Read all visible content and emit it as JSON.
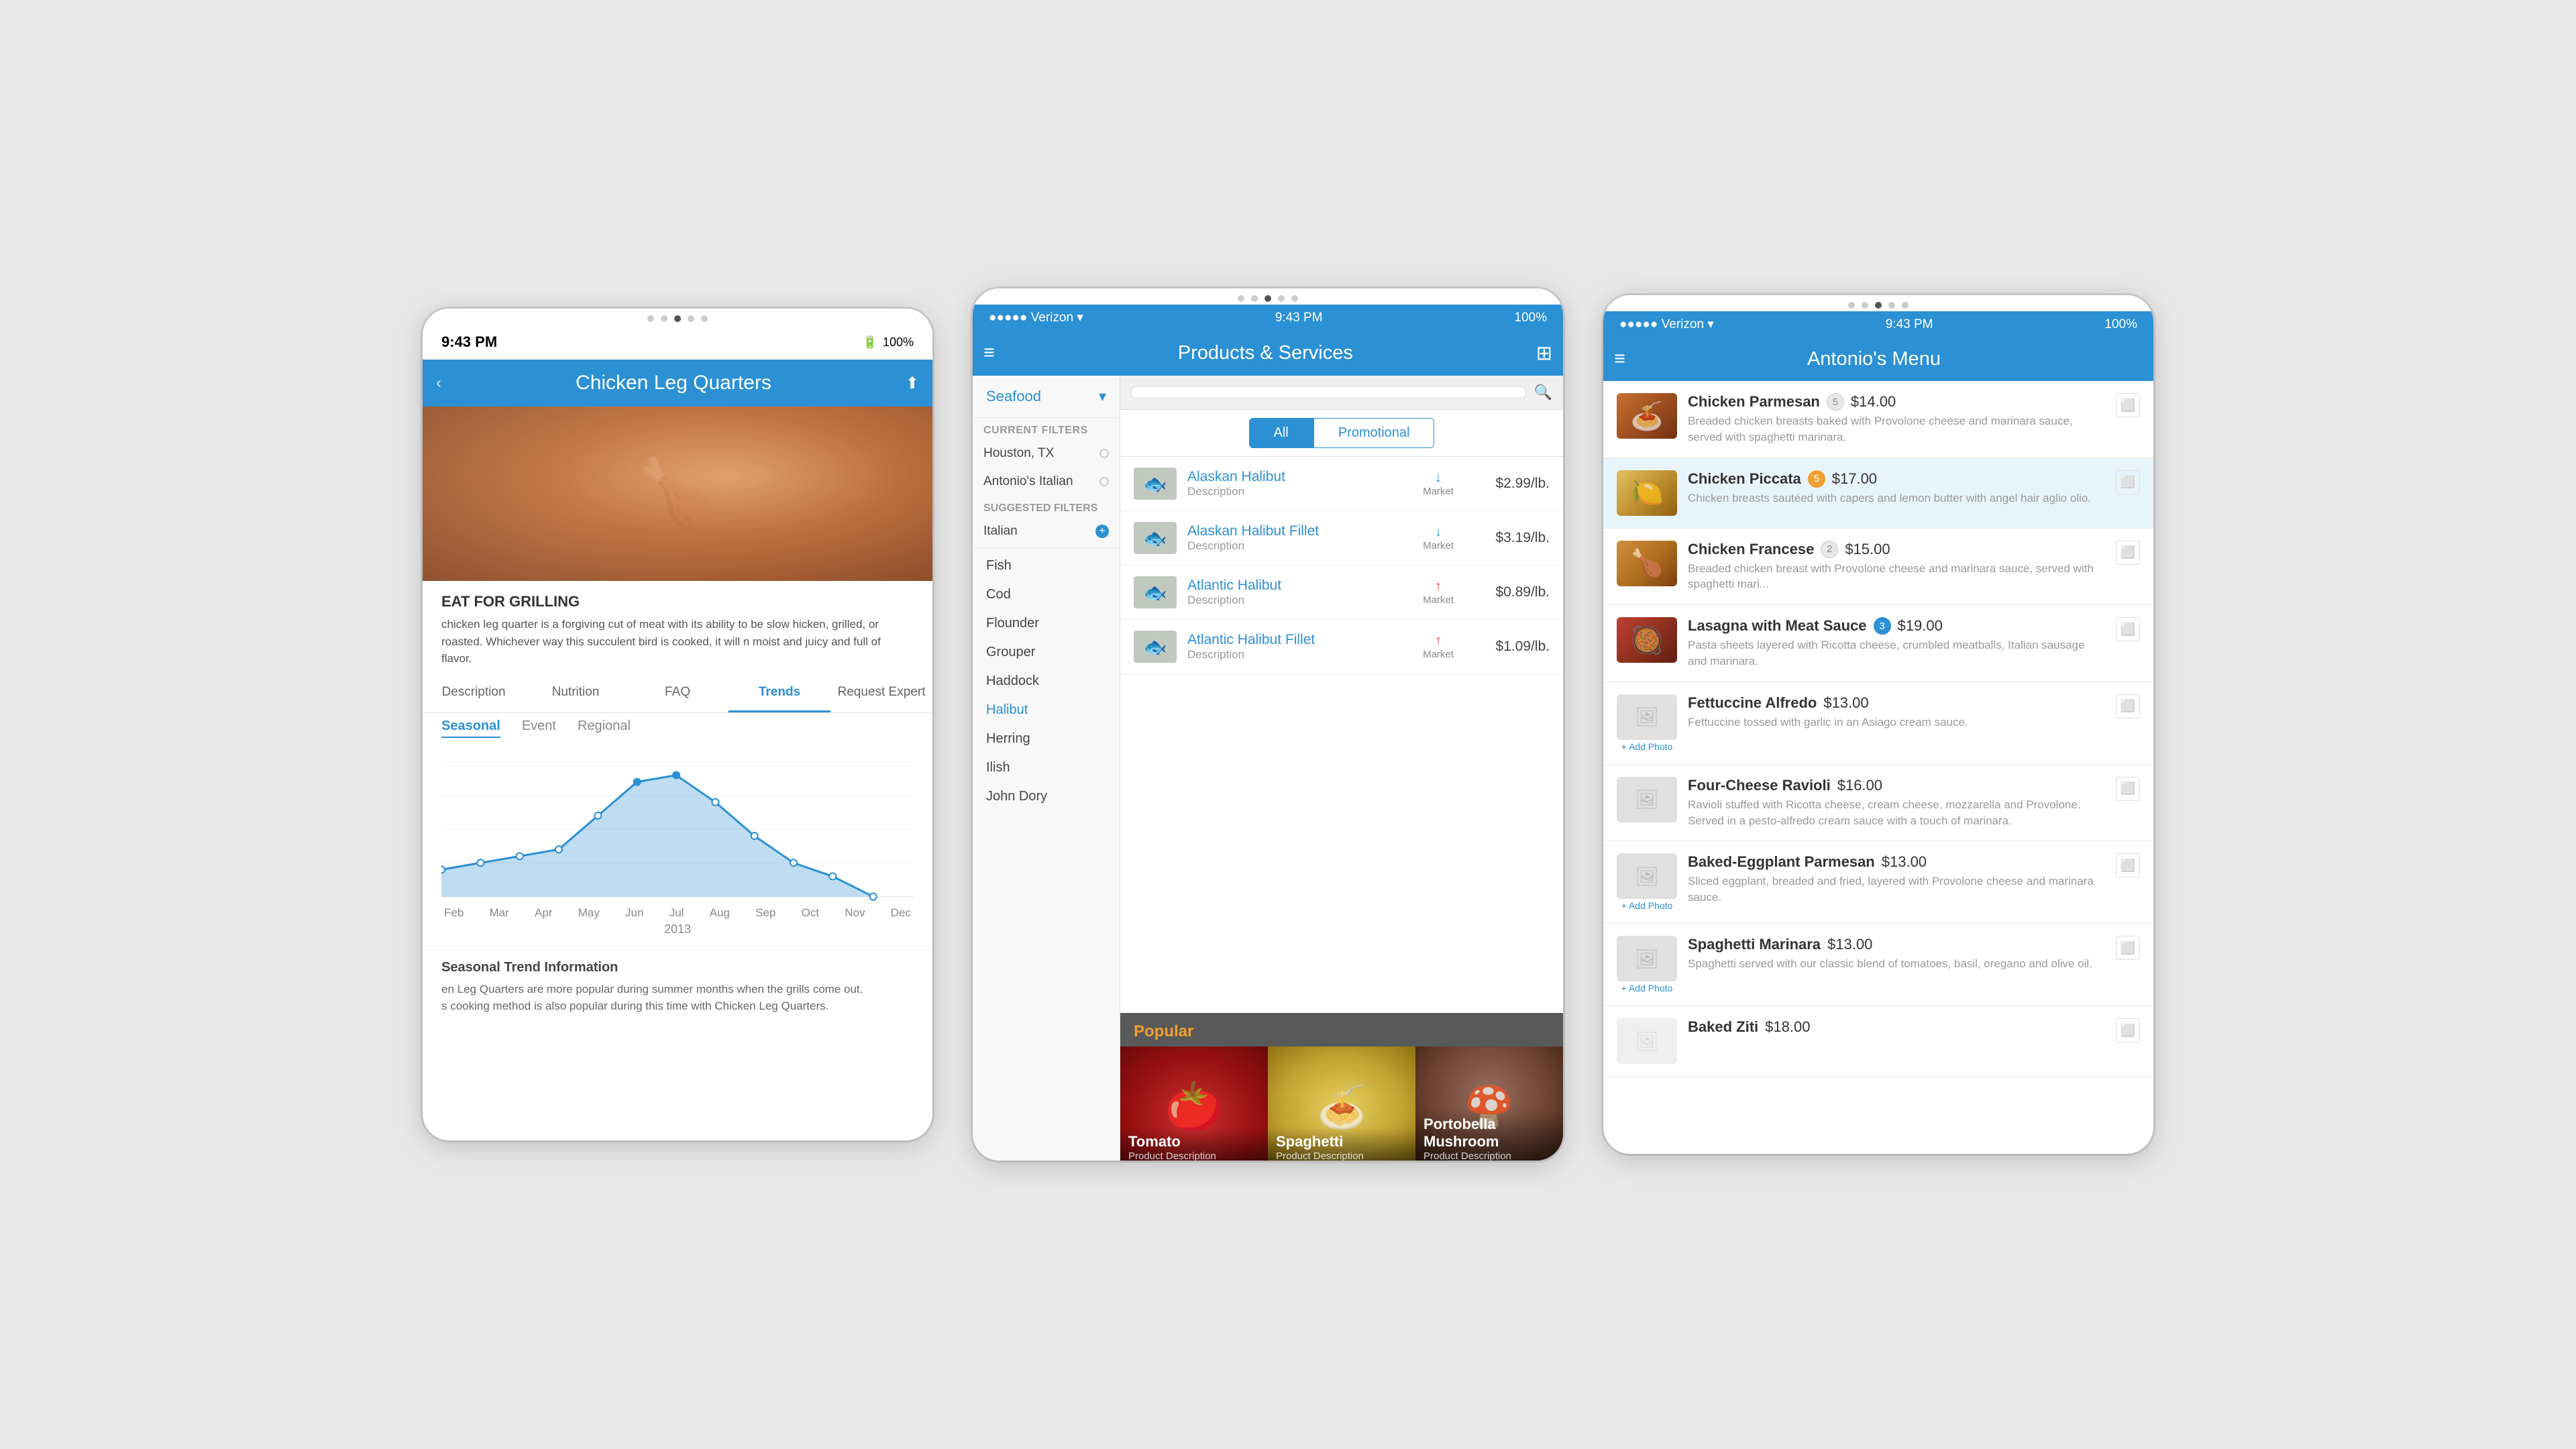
{
  "screen1": {
    "status_bar": {
      "time": "9:43 PM",
      "battery": "100%"
    },
    "header": {
      "title": "Chicken Leg Quarters",
      "back_label": "‹"
    },
    "tabs": [
      {
        "label": "Description",
        "active": false
      },
      {
        "label": "Nutrition",
        "active": false
      },
      {
        "label": "FAQ",
        "active": false
      },
      {
        "label": "Trends",
        "active": true
      },
      {
        "label": "Request Expert",
        "active": false
      }
    ],
    "chart": {
      "section_label": "onal Trend Information",
      "seasonal_label": "Seasonal",
      "event_label": "Event",
      "regional_label": "Regional",
      "year": "2013",
      "months": [
        "Feb",
        "Mar",
        "Apr",
        "May",
        "Jun",
        "Jul",
        "Aug",
        "Sep",
        "Oct",
        "Nov",
        "Dec",
        "Dec"
      ],
      "x_labels": [
        "Feb",
        "Mar",
        "Apr",
        "May",
        "Jun",
        "Jul",
        "Aug",
        "Sep",
        "Oct",
        "Nov",
        "Dec"
      ]
    },
    "trend_section": {
      "title": "onal Trend Information",
      "text_line1": "en Leg Quarters are more popular during summer months when the grills come out.",
      "text_line2": "s cooking method is also popular during this time with Chicken Leg Quarters."
    },
    "body_text": {
      "heading": "EAT FOR GRILLING",
      "para": "chicken leg quarter is a forgiving cut of meat with its ability to be slow\nhicken, grilled, or roasted. Whichever way this succulent bird is cooked, it will\nn moist and juicy and full of flavor."
    }
  },
  "screen2": {
    "status_bar": {
      "carrier": "●●●●● Verizon ▾",
      "time": "9:43 PM",
      "battery": "100%"
    },
    "header": {
      "title": "Products & Services",
      "menu_icon": "≡",
      "barcode_icon": "⊞"
    },
    "sidebar": {
      "category": "Seafood",
      "chevron": "▾",
      "current_filters_label": "Current Filters",
      "filters": [
        {
          "label": "Houston, TX",
          "checked": false
        },
        {
          "label": "Antonio's Italian",
          "checked": false
        }
      ],
      "suggested_filters_label": "Suggested Filters",
      "suggested_items": [
        {
          "label": "Italian",
          "has_add": true
        }
      ],
      "fish_items": [
        {
          "label": "Fish",
          "active": false,
          "indent": false
        },
        {
          "label": "Cod",
          "active": false
        },
        {
          "label": "Flounder",
          "active": false
        },
        {
          "label": "Grouper",
          "active": false
        },
        {
          "label": "Haddock",
          "active": false
        },
        {
          "label": "Halibut",
          "active": true
        },
        {
          "label": "Herring",
          "active": false
        },
        {
          "label": "Ilish",
          "active": false
        },
        {
          "label": "John Dory",
          "active": false
        }
      ]
    },
    "filter_bar": {
      "all_label": "All",
      "promo_label": "Promotional"
    },
    "products": [
      {
        "name": "Alaskan Halibut",
        "desc": "Description",
        "trend": "down",
        "trend_label": "Market",
        "price": "$2.99/lb."
      },
      {
        "name": "Alaskan Halibut Fillet",
        "desc": "Description",
        "trend": "down",
        "trend_label": "Market",
        "price": "$3.19/lb."
      },
      {
        "name": "Atlantic Halibut",
        "desc": "Description",
        "trend": "up",
        "trend_label": "Market",
        "price": "$0.89/lb."
      },
      {
        "name": "Atlantic Halibut Fillet",
        "desc": "Description",
        "trend": "up",
        "trend_label": "Market",
        "price": "$1.09/lb."
      }
    ],
    "popular": {
      "title": "Popular",
      "items": [
        {
          "name": "Tomato",
          "desc": "Product Description"
        },
        {
          "name": "Spaghetti",
          "desc": "Product Description"
        },
        {
          "name": "Portobella Mushroom",
          "desc": "Product Description"
        }
      ]
    }
  },
  "screen3": {
    "status_bar": {
      "carrier": "●●●●● Verizon ▾",
      "time": "9:43 PM",
      "battery": "100%"
    },
    "header": {
      "title": "Antonio's Menu",
      "menu_icon": "≡"
    },
    "menu_items": [
      {
        "name": "Chicken Parmesan",
        "badge": "5",
        "badge_type": "none",
        "price": "$14.00",
        "desc": "Breaded chicken breasts baked with Provolone cheese and marinara sauce, served with spaghetti marinara.",
        "has_photo": true,
        "selected": false
      },
      {
        "name": "Chicken Piccata",
        "badge": "5",
        "badge_type": "orange",
        "price": "$17.00",
        "desc": "Chicken breasts sautéed with capers and lemon butter with angel hair aglio olio.",
        "has_photo": true,
        "selected": true
      },
      {
        "name": "Chicken Francese",
        "badge": "2",
        "badge_type": "none",
        "price": "$15.00",
        "desc": "Breaded chicken breast with Provolone cheese and marinara sauce, served with spaghetti mari...",
        "has_photo": true,
        "selected": false
      },
      {
        "name": "Lasagna with Meat Sauce",
        "badge": "3",
        "badge_type": "blue",
        "price": "$19.00",
        "desc": "Pasta sheets layered with Ricotta cheese, crumbled meatballs, Italian sausage and marinara.",
        "has_photo": true,
        "selected": false
      },
      {
        "name": "Fettuccine Alfredo",
        "badge": null,
        "price": "$13.00",
        "desc": "Fettuccine tossed with garlic in an Asiago cream sauce.",
        "has_photo": false,
        "add_photo": true,
        "selected": false
      },
      {
        "name": "Four-Cheese Ravioli",
        "badge": null,
        "price": "$16.00",
        "desc": "Ravioli stuffed with Ricotta cheese, cream cheese, mozzarella and Provolone. Served in a pesto-alfredo cream sauce with a touch of marinara.",
        "has_photo": false,
        "add_photo": false,
        "selected": false
      },
      {
        "name": "Baked-Eggplant Parmesan",
        "badge": null,
        "price": "$13.00",
        "desc": "Sliced eggplant, breaded and fried, layered with Provolone cheese and marinara sauce.",
        "has_photo": false,
        "add_photo": true,
        "selected": false
      },
      {
        "name": "Spaghetti Marinara",
        "badge": null,
        "price": "$13.00",
        "desc": "Spaghetti served with our classic blend of tomatoes, basil, oregano and olive oil.",
        "has_photo": false,
        "add_photo": true,
        "selected": false
      },
      {
        "name": "Baked Ziti",
        "badge": null,
        "price": "$18.00",
        "desc": "",
        "has_photo": false,
        "add_photo": false,
        "selected": false
      }
    ]
  }
}
